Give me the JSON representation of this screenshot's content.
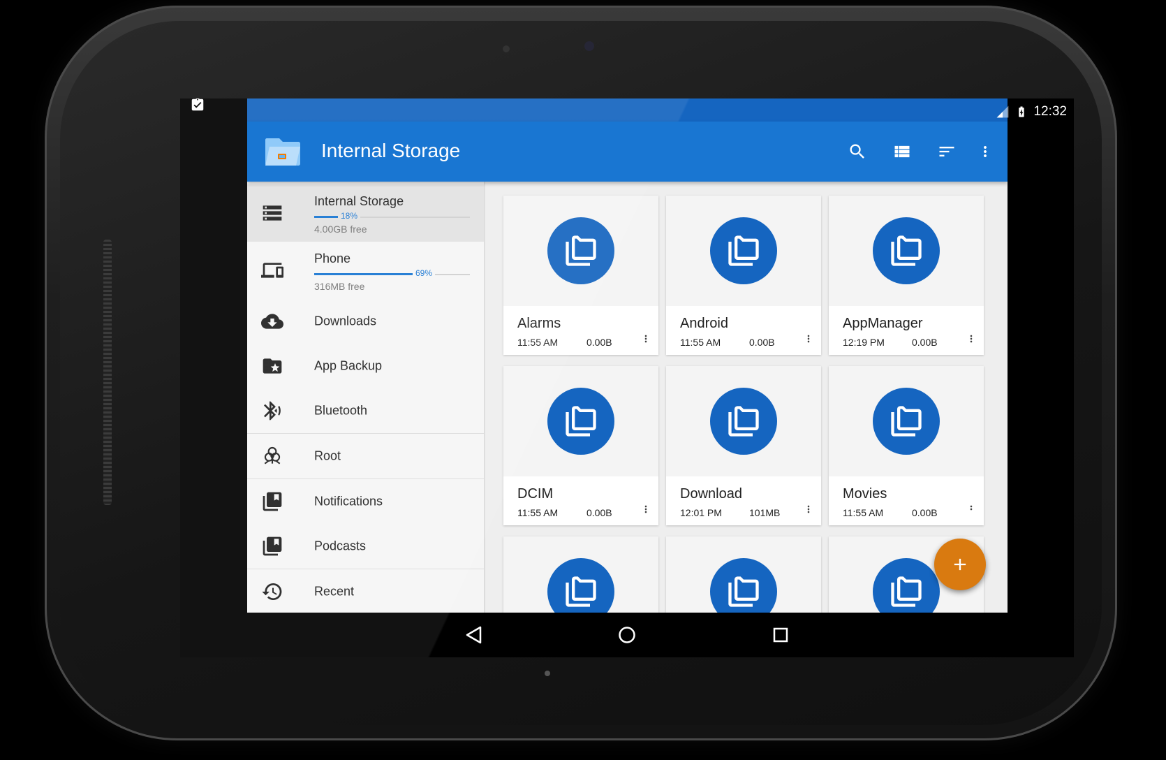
{
  "statusbar": {
    "time": "12:32"
  },
  "toolbar": {
    "title": "Internal Storage"
  },
  "drawer": {
    "storages": [
      {
        "label": "Internal Storage",
        "percent_label": "18%",
        "percent": 18,
        "free": "4.00GB free"
      },
      {
        "label": "Phone",
        "percent_label": "69%",
        "percent": 69,
        "free": "316MB free"
      }
    ],
    "items": [
      {
        "label": "Downloads",
        "icon": "cloud-download-icon"
      },
      {
        "label": "App Backup",
        "icon": "folder-star-icon"
      },
      {
        "label": "Bluetooth",
        "icon": "bluetooth-icon"
      },
      {
        "label": "Root",
        "icon": "biohazard-icon"
      },
      {
        "label": "Notifications",
        "icon": "library-icon"
      },
      {
        "label": "Podcasts",
        "icon": "library-icon"
      },
      {
        "label": "Recent",
        "icon": "history-icon"
      }
    ]
  },
  "files": [
    {
      "name": "Alarms",
      "time": "11:55 AM",
      "size": "0.00B"
    },
    {
      "name": "Android",
      "time": "11:55 AM",
      "size": "0.00B"
    },
    {
      "name": "AppManager",
      "time": "12:19 PM",
      "size": "0.00B"
    },
    {
      "name": "DCIM",
      "time": "11:55 AM",
      "size": "0.00B"
    },
    {
      "name": "Download",
      "time": "12:01 PM",
      "size": "101MB"
    },
    {
      "name": "Movies",
      "time": "11:55 AM",
      "size": "0.00B"
    },
    {
      "name": "",
      "time": "",
      "size": ""
    },
    {
      "name": "",
      "time": "",
      "size": ""
    },
    {
      "name": "",
      "time": "",
      "size": ""
    }
  ],
  "colors": {
    "primary": "#1976d2",
    "primary_dark": "#1565c0",
    "accent": "#d97a10"
  }
}
